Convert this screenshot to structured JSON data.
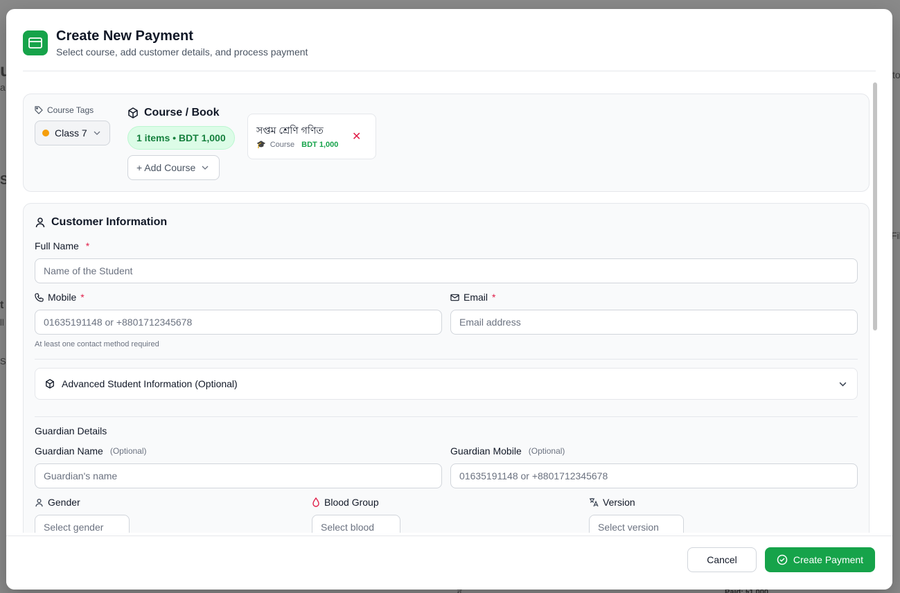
{
  "background": {
    "fragments": [
      "u",
      "a",
      "S",
      "S",
      "t",
      "ll",
      "S",
      "to",
      "Fil"
    ],
    "bottom_text": [
      "ন",
      "Paid: ৳1,000"
    ]
  },
  "header": {
    "title": "Create New Payment",
    "subtitle": "Select course, add customer details, and process payment",
    "icon": "credit-card-icon"
  },
  "course_section": {
    "tags_label": "Course Tags",
    "tag_value": "Class 7",
    "tag_color": "#f59e0b",
    "title": "Course / Book",
    "items_badge": "1 items • BDT 1,000",
    "add_course_label": "+ Add Course",
    "selected_items": [
      {
        "name": "সপ্তম শ্রেণি গণিত",
        "type": "Course",
        "price": "BDT 1,000"
      }
    ]
  },
  "customer": {
    "title": "Customer Information",
    "full_name_label": "Full Name",
    "full_name_placeholder": "Name of the Student",
    "mobile_label": "Mobile",
    "mobile_placeholder": "01635191148 or +8801712345678",
    "email_label": "Email",
    "email_placeholder": "Email address",
    "contact_hint": "At least one contact method required",
    "required_mark": "*",
    "advanced_label": "Advanced Student Information (Optional)",
    "guardian_heading": "Guardian Details",
    "guardian_name_label": "Guardian Name",
    "guardian_name_optional": "(Optional)",
    "guardian_name_placeholder": "Guardian's name",
    "guardian_mobile_label": "Guardian Mobile",
    "guardian_mobile_optional": "(Optional)",
    "guardian_mobile_placeholder": "01635191148 or +8801712345678",
    "gender_label": "Gender",
    "gender_placeholder": "Select gender",
    "blood_label": "Blood Group",
    "blood_placeholder": "Select blood",
    "version_label": "Version",
    "version_placeholder": "Select version"
  },
  "footer": {
    "cancel_label": "Cancel",
    "create_label": "Create Payment"
  },
  "colors": {
    "accent": "#16a34a",
    "required": "#e11d48"
  }
}
